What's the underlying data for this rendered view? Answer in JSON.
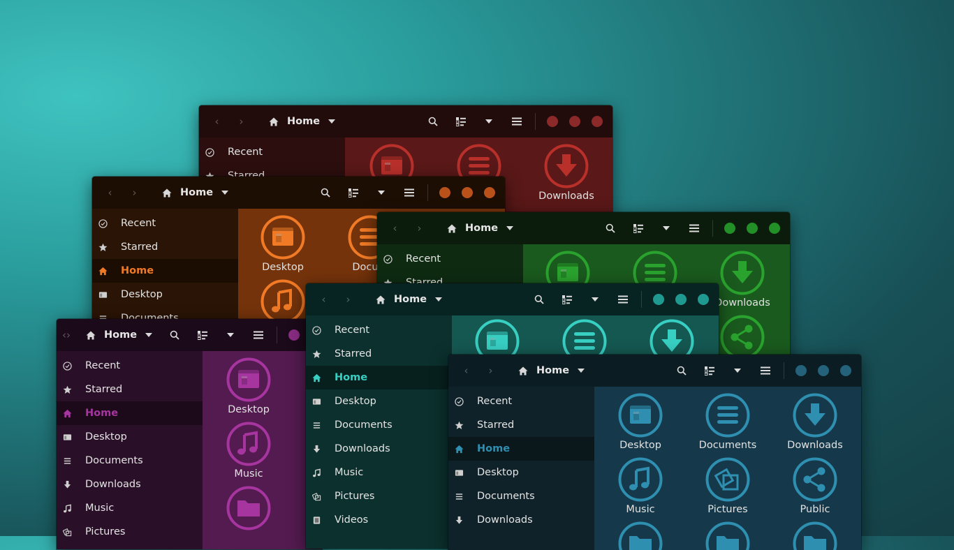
{
  "windows": [
    {
      "id": "red",
      "colors": {
        "accent": "#b9302b",
        "header": "#220b0b",
        "sidebar": "#2c0e0e",
        "main": "#5a1818",
        "close": "#8c2a2a"
      },
      "header": {
        "location": "Home"
      },
      "sidebar": {
        "items": [
          {
            "label": "Recent",
            "icon": "clock-icon"
          },
          {
            "label": "Starred",
            "icon": "star-icon"
          }
        ]
      },
      "main": {
        "tiles": [
          {
            "label": "",
            "icon": "desktop-folder-icon"
          },
          {
            "label": "",
            "icon": "documents-folder-icon"
          },
          {
            "label": "Downloads",
            "icon": "downloads-folder-icon"
          }
        ]
      }
    },
    {
      "id": "orange",
      "colors": {
        "accent": "#f07a26",
        "header": "#1d0e04",
        "sidebar": "#2a1405",
        "main": "#74330b",
        "close": "#b9521a"
      },
      "header": {
        "location": "Home"
      },
      "sidebar": {
        "items": [
          {
            "label": "Recent",
            "icon": "clock-icon"
          },
          {
            "label": "Starred",
            "icon": "star-icon"
          },
          {
            "label": "Home",
            "icon": "home-icon",
            "active": true
          },
          {
            "label": "Desktop",
            "icon": "desktop-icon"
          },
          {
            "label": "Documents",
            "icon": "documents-icon"
          }
        ]
      },
      "main": {
        "tiles": [
          {
            "label": "Desktop",
            "icon": "desktop-folder-icon"
          },
          {
            "label": "Docum",
            "icon": "documents-folder-icon"
          },
          {
            "label": "",
            "icon": "music-folder-icon"
          }
        ]
      }
    },
    {
      "id": "green",
      "colors": {
        "accent": "#2aa32e",
        "header": "#0b1c0d",
        "sidebar": "#0e2b11",
        "main": "#1a5a1e",
        "close": "#239027"
      },
      "header": {
        "location": "Home"
      },
      "sidebar": {
        "items": [
          {
            "label": "Recent",
            "icon": "clock-icon"
          },
          {
            "label": "Starred",
            "icon": "star-icon"
          }
        ]
      },
      "main": {
        "tiles": [
          {
            "label": "",
            "icon": "desktop-folder-icon"
          },
          {
            "label": "",
            "icon": "documents-folder-icon"
          },
          {
            "label": "Downloads",
            "icon": "downloads-folder-icon"
          },
          {
            "label": "",
            "icon": "public-folder-icon"
          }
        ]
      }
    },
    {
      "id": "purple",
      "colors": {
        "accent": "#a6359f",
        "header": "#1b0a1a",
        "sidebar": "#2a0f28",
        "main": "#531b4f",
        "close": "#8a2c84"
      },
      "header": {
        "location": "Home"
      },
      "sidebar": {
        "items": [
          {
            "label": "Recent",
            "icon": "clock-icon"
          },
          {
            "label": "Starred",
            "icon": "star-icon"
          },
          {
            "label": "Home",
            "icon": "home-icon",
            "active": true
          },
          {
            "label": "Desktop",
            "icon": "desktop-icon"
          },
          {
            "label": "Documents",
            "icon": "documents-icon"
          },
          {
            "label": "Downloads",
            "icon": "downloads-icon"
          },
          {
            "label": "Music",
            "icon": "music-icon"
          },
          {
            "label": "Pictures",
            "icon": "pictures-icon"
          }
        ]
      },
      "main": {
        "tiles": [
          {
            "label": "Desktop",
            "icon": "desktop-folder-icon"
          },
          {
            "label": "Music",
            "icon": "music-folder-icon"
          },
          {
            "label": "",
            "icon": "folder-icon"
          }
        ]
      }
    },
    {
      "id": "teal",
      "colors": {
        "accent": "#38cfc3",
        "header": "#082422",
        "sidebar": "#0b302d",
        "main": "#155852",
        "close": "#1f9a90"
      },
      "header": {
        "location": "Home"
      },
      "sidebar": {
        "items": [
          {
            "label": "Recent",
            "icon": "clock-icon"
          },
          {
            "label": "Starred",
            "icon": "star-icon"
          },
          {
            "label": "Home",
            "icon": "home-icon",
            "active": true
          },
          {
            "label": "Desktop",
            "icon": "desktop-icon"
          },
          {
            "label": "Documents",
            "icon": "documents-icon"
          },
          {
            "label": "Downloads",
            "icon": "downloads-icon"
          },
          {
            "label": "Music",
            "icon": "music-icon"
          },
          {
            "label": "Pictures",
            "icon": "pictures-icon"
          },
          {
            "label": "Videos",
            "icon": "videos-icon"
          }
        ]
      },
      "main": {
        "tiles": [
          {
            "label": "",
            "icon": "desktop-folder-icon"
          },
          {
            "label": "",
            "icon": "documents-folder-icon"
          },
          {
            "label": "",
            "icon": "downloads-folder-icon"
          }
        ]
      }
    },
    {
      "id": "blue",
      "colors": {
        "accent": "#2f8fb1",
        "header": "#0b1c22",
        "sidebar": "#0f2229",
        "main": "#15394a",
        "close": "#23627a"
      },
      "header": {
        "location": "Home"
      },
      "sidebar": {
        "items": [
          {
            "label": "Recent",
            "icon": "clock-icon"
          },
          {
            "label": "Starred",
            "icon": "star-icon"
          },
          {
            "label": "Home",
            "icon": "home-icon",
            "active": true
          },
          {
            "label": "Desktop",
            "icon": "desktop-icon"
          },
          {
            "label": "Documents",
            "icon": "documents-icon"
          },
          {
            "label": "Downloads",
            "icon": "downloads-icon"
          }
        ]
      },
      "main": {
        "tiles": [
          {
            "label": "Desktop",
            "icon": "desktop-folder-icon"
          },
          {
            "label": "Documents",
            "icon": "documents-folder-icon"
          },
          {
            "label": "Downloads",
            "icon": "downloads-folder-icon"
          },
          {
            "label": "Music",
            "icon": "music-folder-icon"
          },
          {
            "label": "Pictures",
            "icon": "pictures-folder-icon"
          },
          {
            "label": "Public",
            "icon": "public-folder-icon"
          },
          {
            "label": "",
            "icon": "folder-icon"
          },
          {
            "label": "",
            "icon": "folder-icon"
          },
          {
            "label": "",
            "icon": "folder-icon"
          }
        ]
      }
    }
  ]
}
